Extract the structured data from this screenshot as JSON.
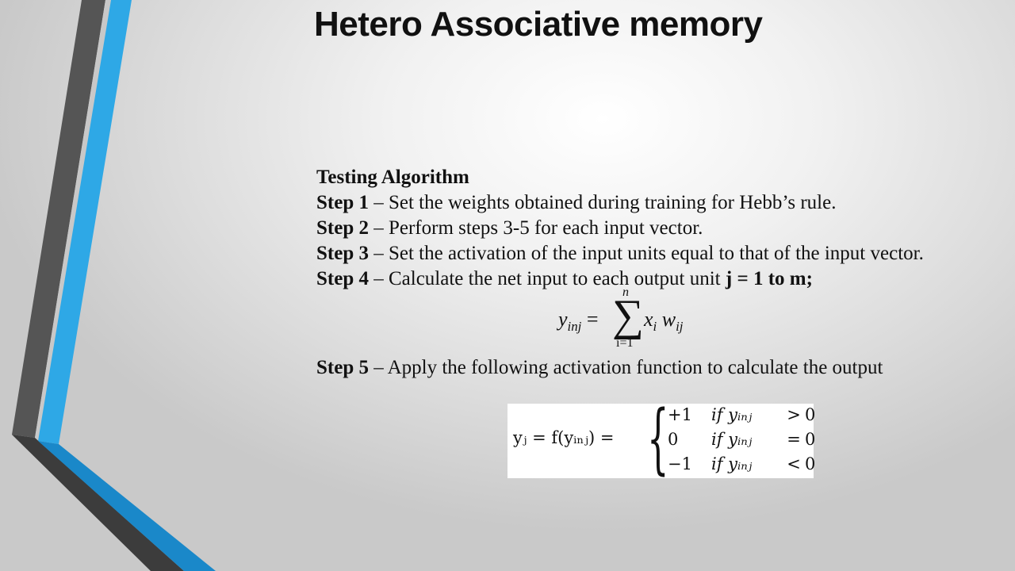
{
  "title": "Hetero Associative memory",
  "section_heading": "Testing Algorithm",
  "steps": [
    {
      "label": "Step 1",
      "text": " – Set the weights obtained during training for Hebb’s rule.",
      "bold_tail": ""
    },
    {
      "label": "Step 2",
      "text": " – Perform steps 3-5 for each input vector.",
      "bold_tail": ""
    },
    {
      "label": "Step 3",
      "text": " – Set the activation of the input units equal to that of the input vector.",
      "bold_tail": ""
    },
    {
      "label": "Step 4",
      "text": " – Calculate the net input to each output unit ",
      "bold_tail": "j = 1 to m;"
    },
    {
      "label": "Step 5",
      "text": " – Apply the following activation function to calculate the output",
      "bold_tail": ""
    }
  ],
  "sum_equation": {
    "lhs_var": "y",
    "lhs_sub": "inj",
    "equals": "=",
    "sigma": "∑",
    "upper": "n",
    "lower": "i=1",
    "x_var": "x",
    "x_sub": "i",
    "w_var": "w",
    "w_sub": "ij"
  },
  "activation_function": {
    "lhs": "yⱼ  =  f(yᵢₙⱼ)  =",
    "brace": "{",
    "rows": [
      {
        "value": "+1",
        "cond": "if yᵢₙⱼ",
        "op": ">",
        "rhs": "0"
      },
      {
        "value": "0",
        "cond": "if yᵢₙⱼ",
        "op": "=",
        "rhs": "0"
      },
      {
        "value": "−1",
        "cond": "if yᵢₙⱼ",
        "op": "<",
        "rhs": "0"
      }
    ]
  },
  "colors": {
    "dark_stripe": "#555555",
    "blue_stripe": "#2ea8e6",
    "deep_blue": "#1a88c9",
    "text": "#111111"
  }
}
